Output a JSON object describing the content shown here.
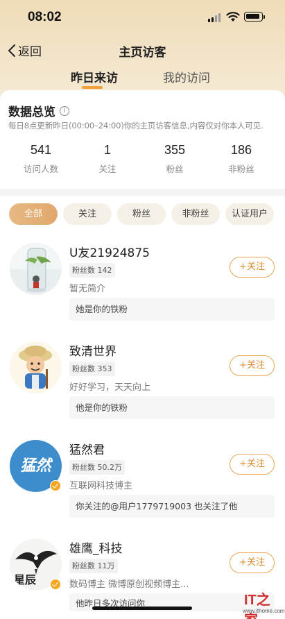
{
  "status_bar": {
    "time": "08:02"
  },
  "nav": {
    "back_label": "返回",
    "title": "主页访客"
  },
  "tabs": [
    {
      "label": "昨日来访",
      "active": true
    },
    {
      "label": "我的访问",
      "active": false
    }
  ],
  "overview": {
    "title": "数据总览",
    "description": "每日8点更新昨日(00:00–24:00)你的主页访客信息,内容仅对你本人可见.",
    "stats": [
      {
        "value": "541",
        "label": "访问人数"
      },
      {
        "value": "1",
        "label": "关注"
      },
      {
        "value": "355",
        "label": "粉丝"
      },
      {
        "value": "186",
        "label": "非粉丝"
      }
    ]
  },
  "filters": [
    {
      "label": "全部",
      "active": true
    },
    {
      "label": "关注",
      "active": false
    },
    {
      "label": "粉丝",
      "active": false
    },
    {
      "label": "非粉丝",
      "active": false
    },
    {
      "label": "认证用户",
      "active": false
    }
  ],
  "follow_label": "+关注",
  "users": [
    {
      "name": "U友21924875",
      "fans": "粉丝数 142",
      "bio": "暂无简介",
      "relation": "她是你的铁粉",
      "verified": false
    },
    {
      "name": "致清世界",
      "fans": "粉丝数 353",
      "bio": "好好学习，天天向上",
      "relation": "他是你的铁粉",
      "verified": false
    },
    {
      "name": "猛然君",
      "fans": "粉丝数 50.2万",
      "bio": "互联网科技博主",
      "relation": "你关注的@用户1779719003 也关注了他",
      "verified": true,
      "avatar_text": "猛然"
    },
    {
      "name": "雄鹰_科技",
      "fans": "粉丝数 11万",
      "bio": "数码博主 微博原创视频博主...",
      "relation": "他昨日多次访问你",
      "verified": true,
      "avatar_text": "星辰"
    }
  ],
  "watermark": {
    "logo": "IT之家",
    "url": "www.ithome.com"
  },
  "colors": {
    "accent": "#f0a23c",
    "follow": "#d88a2a",
    "chip_bg": "#f5f0e6"
  }
}
